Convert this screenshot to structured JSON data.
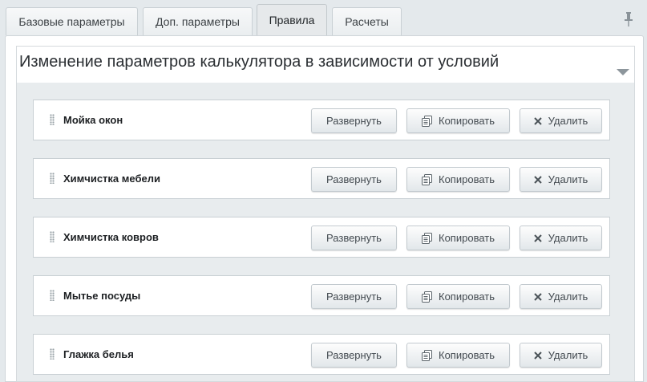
{
  "tabs": [
    {
      "label": "Базовые параметры"
    },
    {
      "label": "Доп. параметры"
    },
    {
      "label": "Правила",
      "active": true
    },
    {
      "label": "Расчеты"
    }
  ],
  "icons": {
    "pin": "pin-icon",
    "collapse": "triangle-down-icon",
    "drag": "drag-handle-icon",
    "copy": "copy-icon",
    "delete": "close-icon"
  },
  "section": {
    "title": "Изменение параметров калькулятора в зависимости от условий"
  },
  "buttons": {
    "expand_label": "Развернуть",
    "copy_label": "Копировать",
    "delete_label": "Удалить"
  },
  "rules": [
    {
      "name": "Мойка окон"
    },
    {
      "name": "Химчистка мебели"
    },
    {
      "name": "Химчистка ковров"
    },
    {
      "name": "Мытье посуды"
    },
    {
      "name": "Глажка белья"
    }
  ],
  "colors": {
    "background": "#e4e9ec",
    "panel": "#ffffff",
    "button_border": "#c3cacf"
  }
}
